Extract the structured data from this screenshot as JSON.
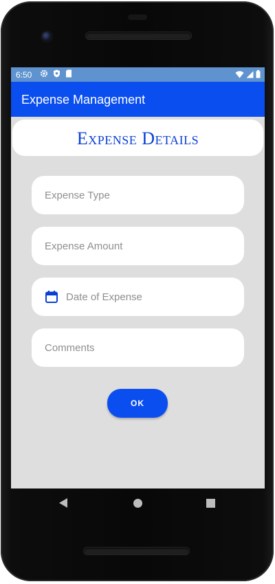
{
  "status_bar": {
    "time": "6:50",
    "left_icons": [
      "gear-icon",
      "shield-icon",
      "sd-card-icon"
    ],
    "right_icons": [
      "wifi-icon",
      "signal-icon",
      "battery-icon"
    ]
  },
  "app_bar": {
    "title": "Expense Management"
  },
  "header": {
    "title": "Expense Details"
  },
  "form": {
    "expense_type_placeholder": "Expense Type",
    "expense_amount_placeholder": "Expense Amount",
    "date_placeholder": "Date of Expense",
    "date_icon": "calendar-icon",
    "comments_placeholder": "Comments",
    "ok_label": "OK"
  },
  "nav_bar": {
    "buttons": [
      "back-icon",
      "home-icon",
      "recents-icon"
    ]
  },
  "colors": {
    "accent": "#0a4ef0",
    "status_bar": "#5f93cf",
    "screen_background": "#dedede",
    "header_text": "#0a3fd6"
  }
}
